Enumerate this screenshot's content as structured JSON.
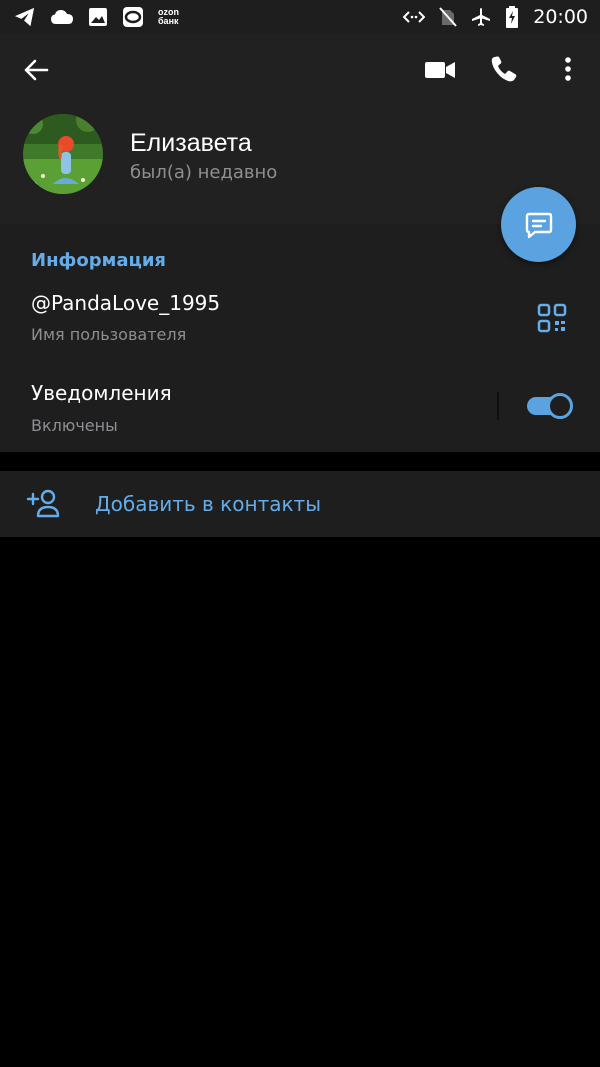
{
  "status_bar": {
    "time": "20:00",
    "ozon_top": "ozon",
    "ozon_bottom": "банк",
    "icons": [
      "telegram-icon",
      "cloud-icon",
      "gallery-icon",
      "o-app-icon",
      "ozon-bank-icon",
      "data-arrows-icon",
      "no-sim-icon",
      "airplane-icon",
      "battery-charging-icon"
    ]
  },
  "header": {
    "name": "Елизавета",
    "status": "был(а) недавно"
  },
  "info": {
    "section_title": "Информация",
    "username": "@PandaLove_1995",
    "username_label": "Имя пользователя",
    "notifications_title": "Уведомления",
    "notifications_status": "Включены",
    "notifications_enabled": true
  },
  "actions": {
    "add_contact_label": "Добавить в контакты"
  },
  "colors": {
    "accent": "#5aa2e0",
    "link": "#64acea",
    "header_bg": "#212121",
    "section_bg": "#1e1e1e",
    "page_bg": "#000000",
    "secondary_text": "#8e8e93"
  }
}
